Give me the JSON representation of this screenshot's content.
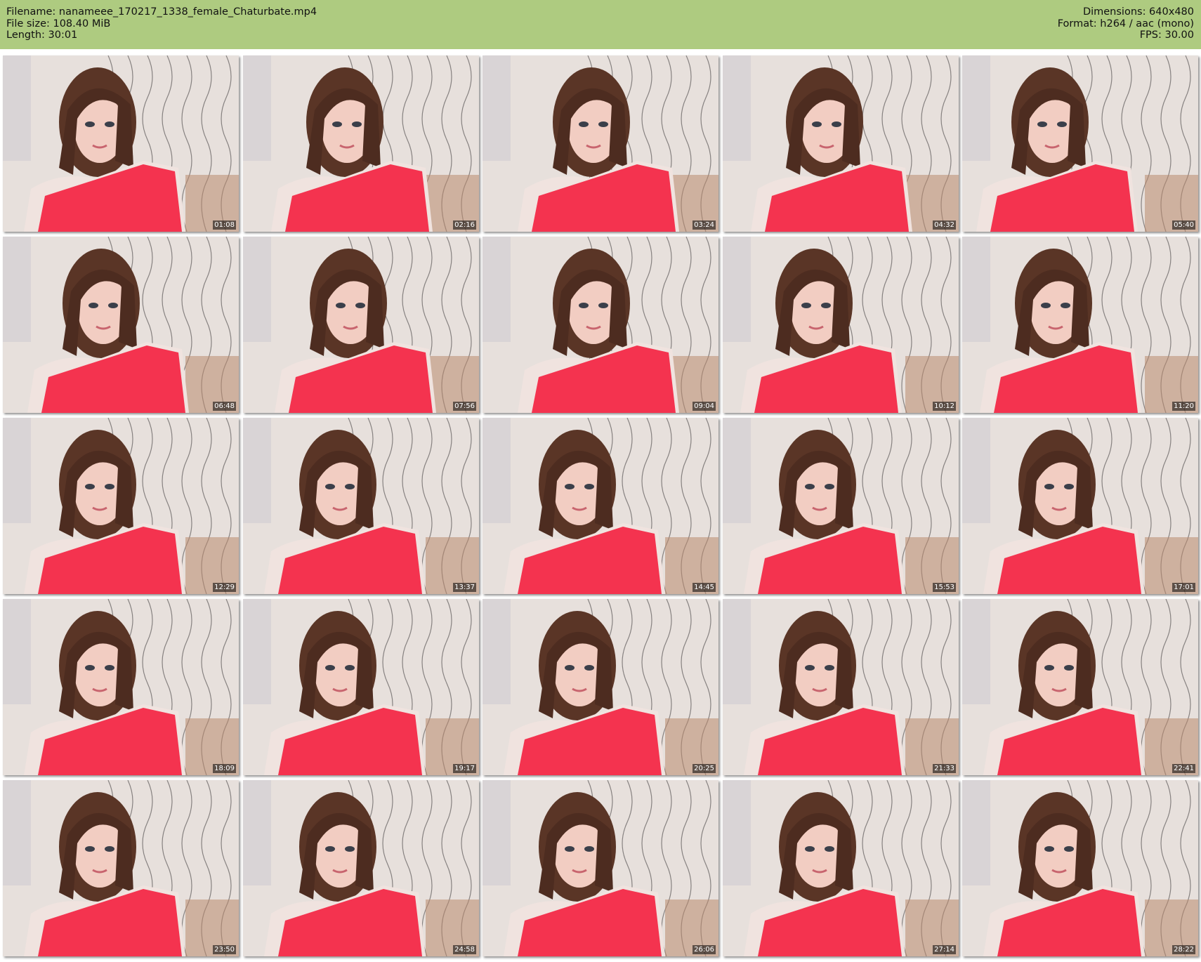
{
  "header": {
    "filename": "Filename: nanameee_170217_1338_female_Chaturbate.mp4",
    "filesize": "File size: 108.40 MiB",
    "length": "Length: 30:01",
    "dimensions": "Dimensions: 640x480",
    "format": "Format: h264 / aac (mono)",
    "fps": "FPS: 30.00"
  },
  "thumbnails": [
    "01:08",
    "02:16",
    "03:24",
    "04:32",
    "05:40",
    "06:48",
    "07:56",
    "09:04",
    "10:12",
    "11:20",
    "12:29",
    "13:37",
    "14:45",
    "15:53",
    "17:01",
    "18:09",
    "19:17",
    "20:25",
    "21:33",
    "22:41",
    "23:50",
    "24:58",
    "26:06",
    "27:14",
    "28:22"
  ],
  "colors": {
    "header_bg": "#aecb80",
    "top_red": "#f4334f",
    "wall": "#e7e0dc"
  }
}
